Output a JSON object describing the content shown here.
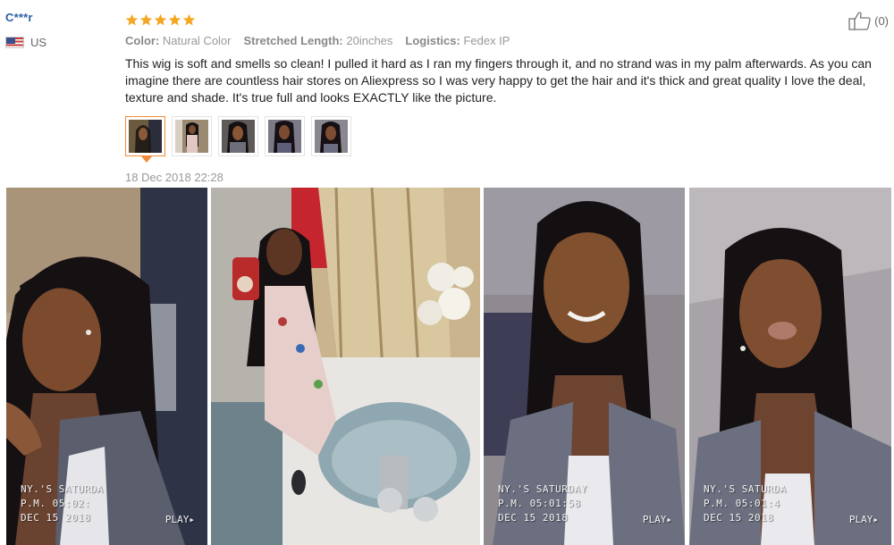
{
  "reviewer": {
    "name": "C***r",
    "country": "US"
  },
  "review": {
    "rating": 5,
    "attributes": [
      {
        "label": "Color:",
        "value": "Natural Color"
      },
      {
        "label": "Stretched Length:",
        "value": "20inches"
      },
      {
        "label": "Logistics:",
        "value": "Fedex IP"
      }
    ],
    "text": "This wig is soft and smells so clean! I pulled it hard as I ran my fingers through it, and no strand was in my palm afterwards. As you can imagine there are countless hair stores on Aliexpress so I was very happy to get the hair and it's thick and great quality I love the deal, texture and shade. It's true full and looks EXACTLY like the picture.",
    "date": "18 Dec 2018 22:28",
    "helpful_count": "(0)",
    "thumbnail_count": 5
  },
  "photos": [
    {
      "line1": "NY.'S SATURDA",
      "line2": "P.M. 05:02:",
      "line3": "DEC 15 2018",
      "play": "PLAY▸"
    },
    {
      "line1": "",
      "line2": "",
      "line3": "",
      "play": ""
    },
    {
      "line1": "NY.'S SATURDAY",
      "line2": "P.M. 05:01:58",
      "line3": "DEC 15 2018",
      "play": "PLAY▸"
    },
    {
      "line1": "NY.'S SATURDA",
      "line2": "P.M. 05:01:4",
      "line3": "DEC 15 2018",
      "play": "PLAY▸"
    }
  ],
  "icons": {
    "star": "star-icon",
    "like": "thumbs-up-icon",
    "flag": "us-flag-icon"
  },
  "colors": {
    "reviewer_name": "#2a5fa5",
    "star": "#f5a623",
    "active_thumb": "#f08c3a"
  }
}
